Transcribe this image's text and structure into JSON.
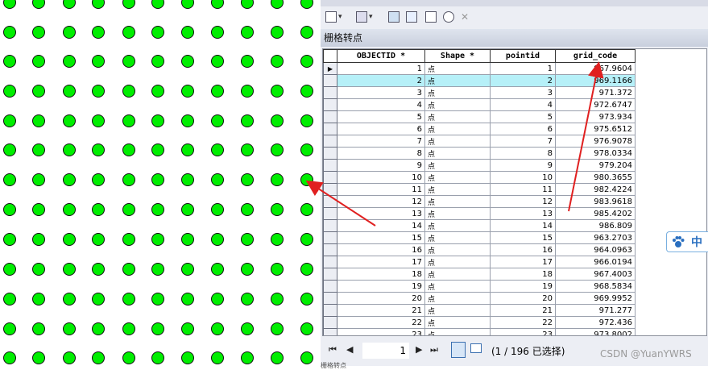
{
  "toolbar": {
    "table_options_icon": "table-options-icon",
    "related_tables_icon": "related-tables-icon",
    "select_by_attributes_icon": "select-by-attributes-icon",
    "switch_selection_icon": "switch-selection-icon",
    "clear_selection_icon": "clear-selection-icon",
    "zoom_to_selected_icon": "zoom-to-selected-icon",
    "delete_selected_icon": "delete-selected-icon",
    "dropdown_glyph": "▾",
    "delete_glyph": "✕"
  },
  "table": {
    "title": "栅格转点",
    "columns": [
      "OBJECTID *",
      "Shape *",
      "pointid",
      "grid_code"
    ],
    "current_row_marker": "▶",
    "highlight_row_index": 1,
    "rows": [
      [
        "1",
        "点",
        "1",
        "967.9604"
      ],
      [
        "2",
        "点",
        "2",
        "969.1166"
      ],
      [
        "3",
        "点",
        "3",
        "971.372"
      ],
      [
        "4",
        "点",
        "4",
        "972.6747"
      ],
      [
        "5",
        "点",
        "5",
        "973.934"
      ],
      [
        "6",
        "点",
        "6",
        "975.6512"
      ],
      [
        "7",
        "点",
        "7",
        "976.9078"
      ],
      [
        "8",
        "点",
        "8",
        "978.0334"
      ],
      [
        "9",
        "点",
        "9",
        "979.204"
      ],
      [
        "10",
        "点",
        "10",
        "980.3655"
      ],
      [
        "11",
        "点",
        "11",
        "982.4224"
      ],
      [
        "12",
        "点",
        "12",
        "983.9618"
      ],
      [
        "13",
        "点",
        "13",
        "985.4202"
      ],
      [
        "14",
        "点",
        "14",
        "986.809"
      ],
      [
        "15",
        "点",
        "15",
        "963.2703"
      ],
      [
        "16",
        "点",
        "16",
        "964.0963"
      ],
      [
        "17",
        "点",
        "17",
        "966.0194"
      ],
      [
        "18",
        "点",
        "18",
        "967.4003"
      ],
      [
        "19",
        "点",
        "19",
        "968.5834"
      ],
      [
        "20",
        "点",
        "20",
        "969.9952"
      ],
      [
        "21",
        "点",
        "21",
        "971.277"
      ],
      [
        "22",
        "点",
        "22",
        "972.436"
      ],
      [
        "23",
        "点",
        "23",
        "973.8002"
      ]
    ]
  },
  "pager": {
    "first": "⏮",
    "prev": "◀",
    "page": "1",
    "next": "▶",
    "last": "⏭",
    "status": "(1 / 196 已选择)"
  },
  "overlay": {
    "watermark": "CSDN @YuanYWRS",
    "ime_label": "中",
    "bottom_text": "栅格转点",
    "colors": {
      "arrow": "#e02020",
      "point_fill": "#00ee00",
      "highlight": "#b6f0f8"
    }
  }
}
